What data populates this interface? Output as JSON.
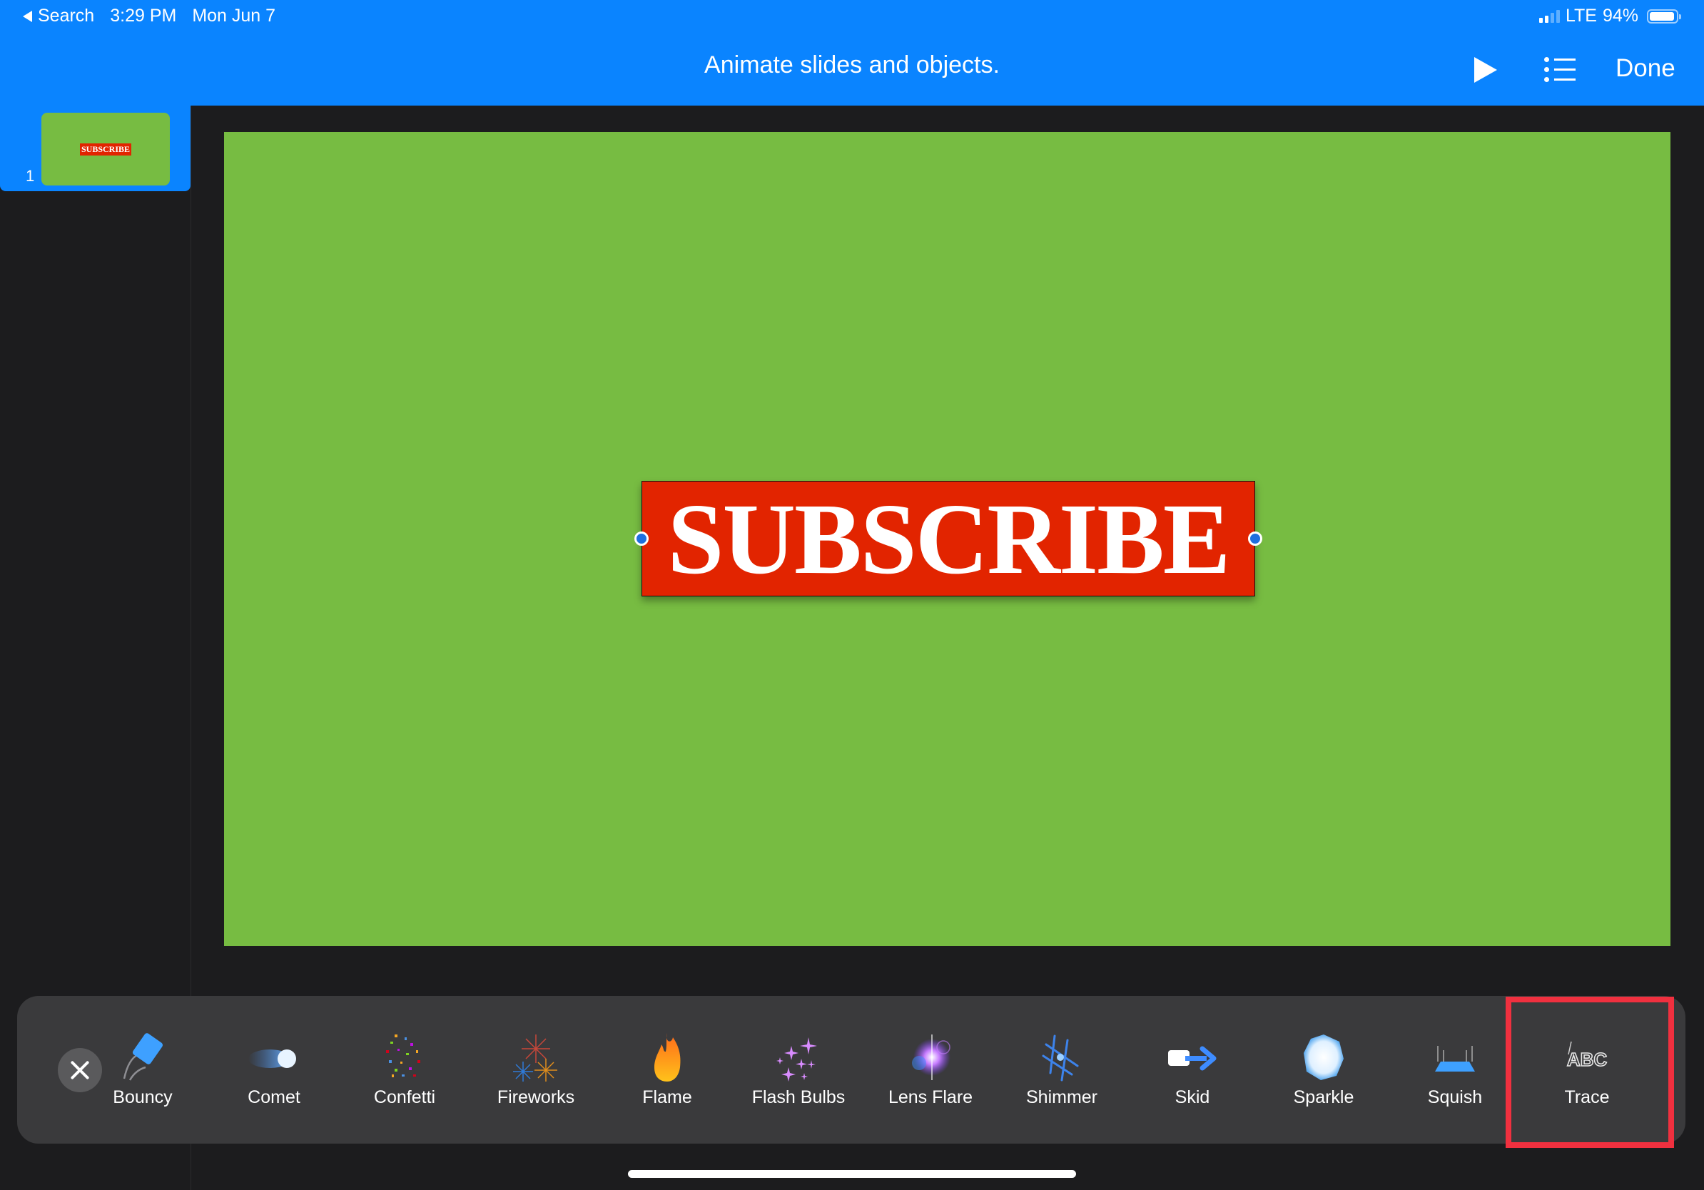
{
  "status_bar": {
    "back_label": "Search",
    "time": "3:29 PM",
    "date": "Mon Jun 7",
    "network": "LTE",
    "battery": "94%",
    "battery_level": 0.94
  },
  "toolbar": {
    "title": "Animate slides and objects.",
    "play_icon": "play-icon",
    "list_icon": "list-icon",
    "done_label": "Done"
  },
  "sidebar": {
    "slides": [
      {
        "number": "1",
        "thumbnail_text": "SUBSCRIBE",
        "selected": true
      }
    ]
  },
  "slide": {
    "background_color": "#77bc42",
    "text_box": {
      "text": "SUBSCRIBE",
      "fill_color": "#e22400",
      "text_color": "#ffffff"
    }
  },
  "effects_bar": {
    "close_icon": "close-icon",
    "selected": "Trace",
    "items": [
      {
        "label": "Bouncy",
        "icon": "bouncy-icon"
      },
      {
        "label": "Comet",
        "icon": "comet-icon"
      },
      {
        "label": "Confetti",
        "icon": "confetti-icon"
      },
      {
        "label": "Fireworks",
        "icon": "fireworks-icon"
      },
      {
        "label": "Flame",
        "icon": "flame-icon"
      },
      {
        "label": "Flash Bulbs",
        "icon": "flash-bulbs-icon"
      },
      {
        "label": "Lens Flare",
        "icon": "lens-flare-icon"
      },
      {
        "label": "Shimmer",
        "icon": "shimmer-icon"
      },
      {
        "label": "Skid",
        "icon": "skid-icon"
      },
      {
        "label": "Sparkle",
        "icon": "sparkle-icon"
      },
      {
        "label": "Squish",
        "icon": "squish-icon"
      },
      {
        "label": "Trace",
        "icon": "trace-icon",
        "icon_text": "ABC"
      }
    ]
  },
  "colors": {
    "accent": "#0a84ff",
    "background": "#1c1c1e",
    "panel": "#3a3a3c",
    "highlight": "#f0303f"
  }
}
